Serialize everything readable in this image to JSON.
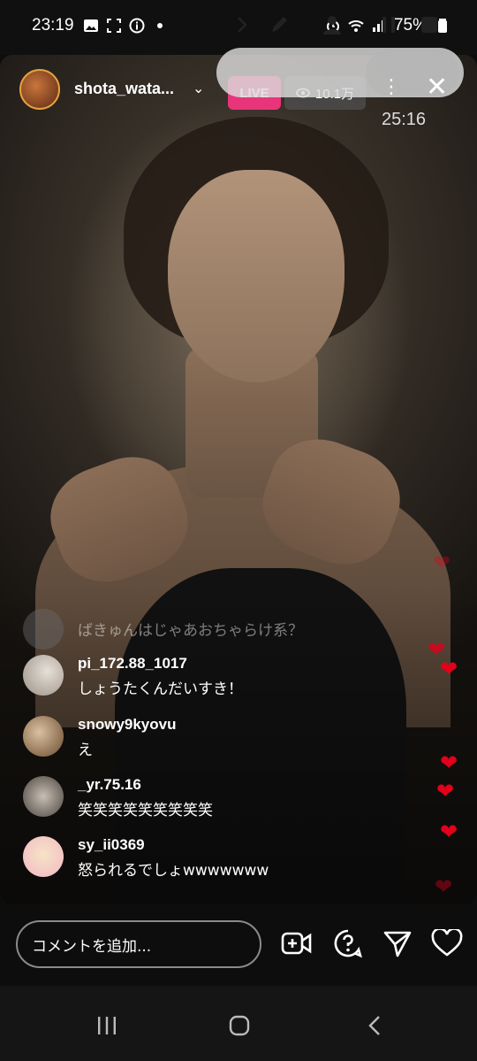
{
  "status_bar": {
    "time": "23:19",
    "battery": "75%",
    "left_icons": [
      "image-icon",
      "screenshot-icon",
      "info-icon",
      "dot-icon"
    ],
    "right_icons": [
      "alarm-icon",
      "wifi-icon",
      "signal-icon",
      "battery-icon"
    ]
  },
  "live": {
    "host_username": "shota_wata...",
    "live_label": "LIVE",
    "viewer_count": "10.1万",
    "recording_time": "25:16"
  },
  "recorder_overlay": {
    "icons": [
      "chevron-right-icon",
      "pen-icon",
      "person-icon",
      "pause-icon",
      "stop-icon"
    ]
  },
  "comments": [
    {
      "user": "",
      "text": "ばきゅんはじゃあおちゃらけ系？",
      "faded": true
    },
    {
      "user": "pi_172.88_1017",
      "text": "しょうたくんだいすき！"
    },
    {
      "user": "snowy9kyovu",
      "text": "え"
    },
    {
      "user": "_yr.75.16",
      "text": "笑笑笑笑笑笑笑笑笑"
    },
    {
      "user": "sy_ii0369",
      "text": "怒られるでしょwwwwwww"
    }
  ],
  "bottom_bar": {
    "comment_placeholder": "コメントを追加...",
    "icons": [
      "add-video-icon",
      "question-icon",
      "send-icon",
      "heart-icon"
    ]
  },
  "nav_bar": {
    "icons": [
      "recents-icon",
      "home-icon",
      "back-icon"
    ]
  },
  "colors": {
    "live_badge": "#e8357a",
    "heart": "#e3001b",
    "background": "#0d0d0d"
  }
}
